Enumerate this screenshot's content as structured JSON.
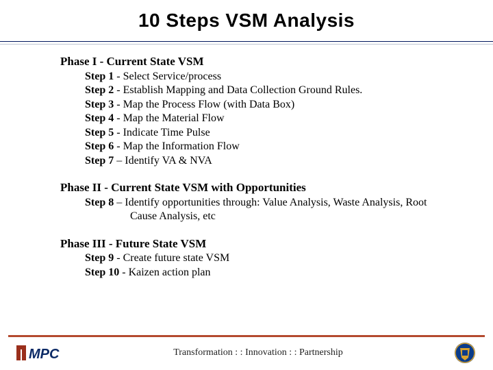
{
  "title": "10 Steps VSM Analysis",
  "phase1": {
    "heading": "Phase I - Current State VSM",
    "steps": [
      {
        "label": "Step 1",
        "sep": " - ",
        "text": "Select Service/process"
      },
      {
        "label": "Step 2",
        "sep": " - ",
        "text": "Establish Mapping and Data Collection Ground Rules."
      },
      {
        "label": "Step 3",
        "sep": " - ",
        "text": "Map the Process Flow (with Data Box)"
      },
      {
        "label": "Step 4",
        "sep": " - ",
        "text": "Map the Material Flow"
      },
      {
        "label": "Step 5",
        "sep": " - ",
        "text": "Indicate Time Pulse"
      },
      {
        "label": "Step 6",
        "sep": " - ",
        "text": "Map the Information Flow"
      },
      {
        "label": "Step 7",
        "sep": " – ",
        "text": "Identify VA & NVA"
      }
    ]
  },
  "phase2": {
    "heading": "Phase II - Current State VSM with Opportunities",
    "steps": [
      {
        "label": "Step 8",
        "sep": " – ",
        "text": "Identify opportunities through: Value Analysis, Waste Analysis, Root Cause Analysis, etc"
      }
    ]
  },
  "phase3": {
    "heading": "Phase III - Future State VSM",
    "steps": [
      {
        "label": "Step 9",
        "sep": " - ",
        "text": "Create future state VSM"
      },
      {
        "label": "Step 10",
        "sep": " - ",
        "text": "Kaizen action plan"
      }
    ]
  },
  "footer": "Transformation : : Innovation : : Partnership"
}
